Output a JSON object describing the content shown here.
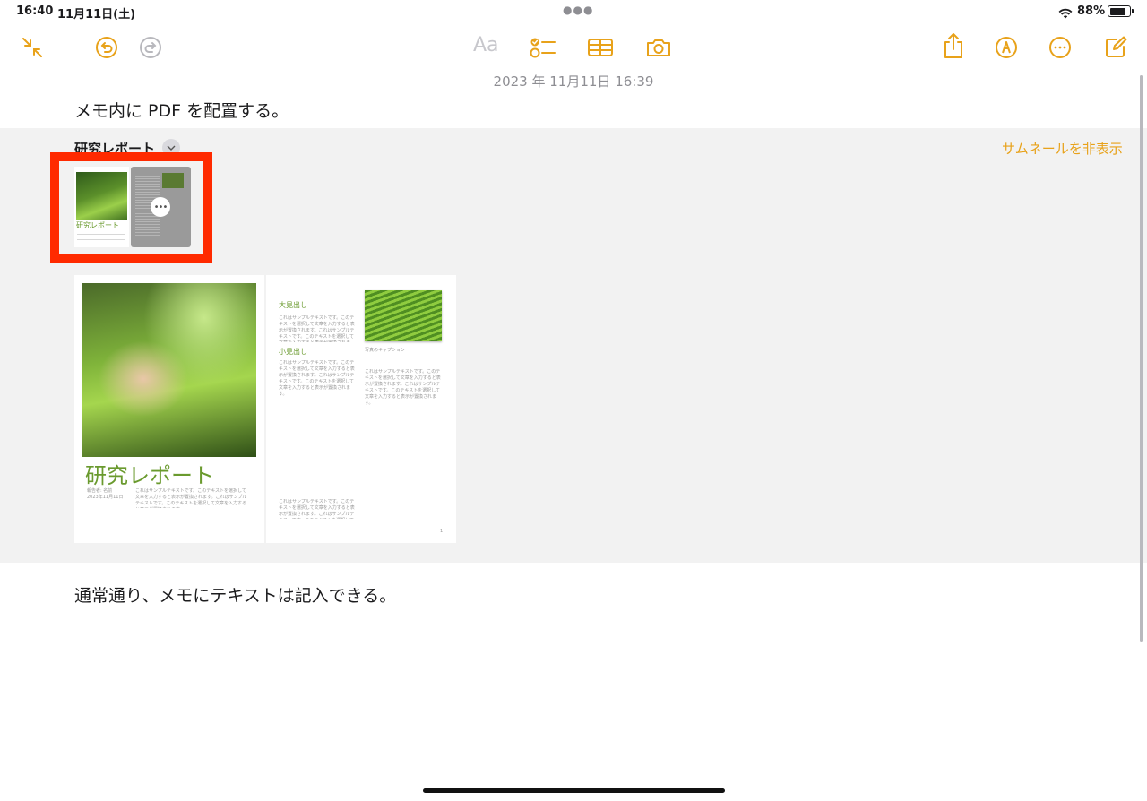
{
  "status_bar": {
    "time": "16:40",
    "date": "11月11日(土)",
    "battery": "88%"
  },
  "toolbar": {
    "text_format_label": "Aa",
    "icons": [
      "collapse-icon",
      "undo-icon",
      "redo-icon",
      "text-format-icon",
      "checklist-icon",
      "table-icon",
      "camera-icon",
      "share-icon",
      "markup-icon",
      "more-icon",
      "compose-icon"
    ],
    "accent_color": "#e8a21a"
  },
  "note": {
    "date": "2023 年 11月11日 16:39",
    "line1": "メモ内に PDF を配置する。",
    "line2": "通常通り、メモにテキストは記入できる。"
  },
  "attachment": {
    "title": "研究レポート",
    "hide_thumbnails": "サムネールを非表示",
    "thumb_caption": "研究レポート",
    "cover": {
      "title": "研究レポート",
      "author": "報告者: 名前",
      "date": "2023年11月11日",
      "body": "これはサンプルテキストです。このテキストを選択して文章を入力すると表示が置換されます。これはサンプルテキストです。このテキストを選択して文章を入力すると表示が置換されます。"
    },
    "page2": {
      "heading_large": "大見出し",
      "heading_small": "小見出し",
      "caption": "写真のキャプション",
      "page_number": "1",
      "body": "これはサンプルテキストです。このテキストを選択して文章を入力すると表示が置換されます。これはサンプルテキストです。このテキストを選択して文章を入力すると表示が置換されます。"
    }
  }
}
